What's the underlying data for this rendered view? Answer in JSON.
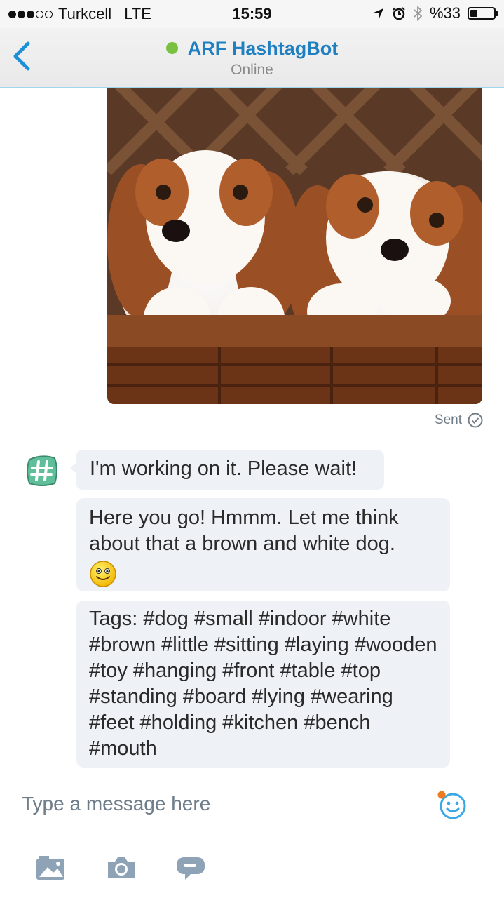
{
  "status_bar": {
    "carrier": "Turkcell",
    "network": "LTE",
    "time": "15:59",
    "battery": "%33",
    "signal_strength": 3,
    "signal_max": 5,
    "battery_level_percent": 33
  },
  "header": {
    "title": "ARF HashtagBot",
    "status": "Online",
    "presence_color": "#7ac142",
    "accent_color": "#1f7fc1"
  },
  "conversation": {
    "outgoing_image_description_icon": "photo",
    "sent_status": "Sent",
    "messages": [
      {
        "text": "I'm working on it. Please wait!"
      },
      {
        "text": "Here you go! Hmmm. Let me think about that a brown and white dog.",
        "emoji": "smiley-emoji"
      },
      {
        "text": "Tags: #dog #small #indoor #white #brown #little #sitting #laying #wooden #toy #hanging #front #table #top #standing #board #lying #wearing #feet #holding #kitchen #bench #mouth"
      }
    ]
  },
  "composer": {
    "placeholder": "Type a message here"
  },
  "icons": {
    "back": "chevron-left-icon",
    "emoji": "smiley-icon",
    "toolbar": [
      "image-icon",
      "camera-icon",
      "chat-bubble-icon"
    ]
  }
}
